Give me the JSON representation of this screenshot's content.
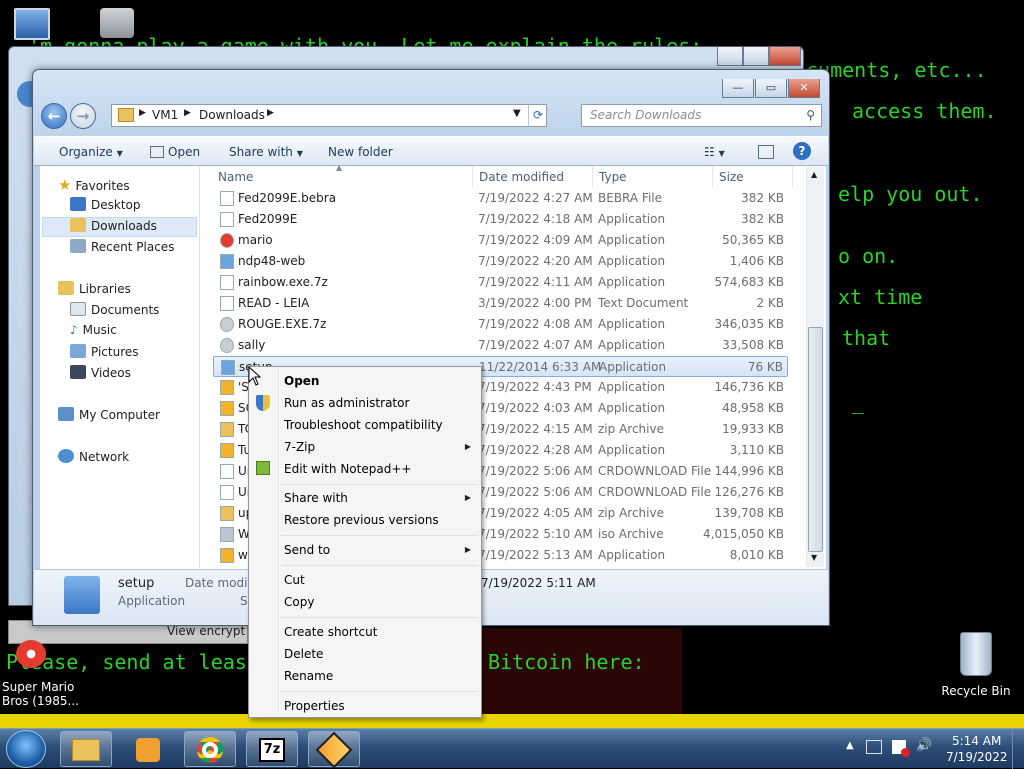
{
  "background_text": {
    "line1": "'m gonna play a game with you. Let me explain the rules:",
    "right1": "cuments, etc...",
    "right2": "access them.",
    "right3": "elp you out.",
    "right4": "o on.",
    "right5": "xt time",
    "right6": "that",
    "cursor": "_",
    "bottom": "Please, send at least",
    "bitcoin": "Bitcoin here:",
    "view_button": "View encrypt"
  },
  "desktop": {
    "mario_label_1": "Super Mario",
    "mario_label_2": "Bros (1985...",
    "recycle_label": "Recycle Bin"
  },
  "window": {
    "address": {
      "seg1": "VM1",
      "seg2": "Downloads"
    },
    "search_placeholder": "Search Downloads",
    "caption": {
      "minimize": "—",
      "maximize": "▭",
      "close": "✕"
    },
    "toolbar": {
      "organize": "Organize",
      "open": "Open",
      "share_with": "Share with",
      "new_folder": "New folder"
    },
    "nav": {
      "favorites": "Favorites",
      "desktop": "Desktop",
      "downloads": "Downloads",
      "recent": "Recent Places",
      "libraries": "Libraries",
      "documents": "Documents",
      "music": "Music",
      "pictures": "Pictures",
      "videos": "Videos",
      "computer": "My Computer",
      "network": "Network"
    },
    "columns": {
      "name": "Name",
      "date": "Date modified",
      "type": "Type",
      "size": "Size"
    },
    "files": [
      {
        "name": "Fed2099E.bebra",
        "date": "7/19/2022 4:27 AM",
        "type": "BEBRA File",
        "size": "382 KB",
        "icon": "file-icon"
      },
      {
        "name": "Fed2099E",
        "date": "7/19/2022 4:18 AM",
        "type": "Application",
        "size": "382 KB",
        "icon": "file-icon"
      },
      {
        "name": "mario",
        "date": "7/19/2022 4:09 AM",
        "type": "Application",
        "size": "50,365 KB",
        "icon": "mario-icon"
      },
      {
        "name": "ndp48-web",
        "date": "7/19/2022 4:20 AM",
        "type": "Application",
        "size": "1,406 KB",
        "icon": "setup-icon"
      },
      {
        "name": "rainbow.exe.7z",
        "date": "7/19/2022 4:11 AM",
        "type": "Application",
        "size": "574,683 KB",
        "icon": "file-icon"
      },
      {
        "name": "READ - LEIA",
        "date": "3/19/2022 4:00 PM",
        "type": "Text Document",
        "size": "2 KB",
        "icon": "text-icon"
      },
      {
        "name": "ROUGE.EXE.7z",
        "date": "7/19/2022 4:08 AM",
        "type": "Application",
        "size": "346,035 KB",
        "icon": "gear-icon"
      },
      {
        "name": "sally",
        "date": "7/19/2022 4:07 AM",
        "type": "Application",
        "size": "33,508 KB",
        "icon": "gear-icon"
      },
      {
        "name": "setup",
        "date": "11/22/2014 6:33 AM",
        "type": "Application",
        "size": "76 KB",
        "icon": "setup-icon"
      },
      {
        "name": "'S",
        "date": "7/19/2022 4:43 PM",
        "type": "Application",
        "size": "146,736 KB",
        "icon": "app-icon"
      },
      {
        "name": "SC",
        "date": "7/19/2022 4:03 AM",
        "type": "Application",
        "size": "48,958 KB",
        "icon": "app-icon"
      },
      {
        "name": "TC",
        "date": "7/19/2022 4:15 AM",
        "type": "zip Archive",
        "size": "19,933 KB",
        "icon": "zip-icon"
      },
      {
        "name": "Tu",
        "date": "7/19/2022 4:28 AM",
        "type": "Application",
        "size": "3,110 KB",
        "icon": "app-icon"
      },
      {
        "name": "Ur",
        "date": "7/19/2022 5:06 AM",
        "type": "CRDOWNLOAD File",
        "size": "144,996 KB",
        "icon": "file-icon"
      },
      {
        "name": "Ur",
        "date": "7/19/2022 5:06 AM",
        "type": "CRDOWNLOAD File",
        "size": "126,276 KB",
        "icon": "file-icon"
      },
      {
        "name": "up",
        "date": "7/19/2022 4:05 AM",
        "type": "zip Archive",
        "size": "139,708 KB",
        "icon": "zip-icon"
      },
      {
        "name": "W",
        "date": "7/19/2022 5:10 AM",
        "type": "iso Archive",
        "size": "4,015,050 KB",
        "icon": "iso-icon"
      },
      {
        "name": "w",
        "date": "7/19/2022 5:13 AM",
        "type": "Application",
        "size": "8,010 KB",
        "icon": "app-icon"
      }
    ],
    "details": {
      "name": "setup",
      "kind": "Application",
      "date_label": "Date modifi",
      "date_value": "7/19/2022 5:11 AM",
      "size_label": "Si"
    }
  },
  "context_menu": {
    "open": "Open",
    "run_admin": "Run as administrator",
    "troubleshoot": "Troubleshoot compatibility",
    "zip": "7-Zip",
    "notepad": "Edit with Notepad++",
    "share_with": "Share with",
    "restore": "Restore previous versions",
    "send_to": "Send to",
    "cut": "Cut",
    "copy": "Copy",
    "create_shortcut": "Create shortcut",
    "delete": "Delete",
    "rename": "Rename",
    "properties": "Properties"
  },
  "taskbar": {
    "time": "5:14 AM",
    "date": "7/19/2022"
  },
  "colors": {
    "terminal_green": "#2bd12b",
    "selection": "#d3e5f9",
    "taskbar": "#2d4e78"
  }
}
